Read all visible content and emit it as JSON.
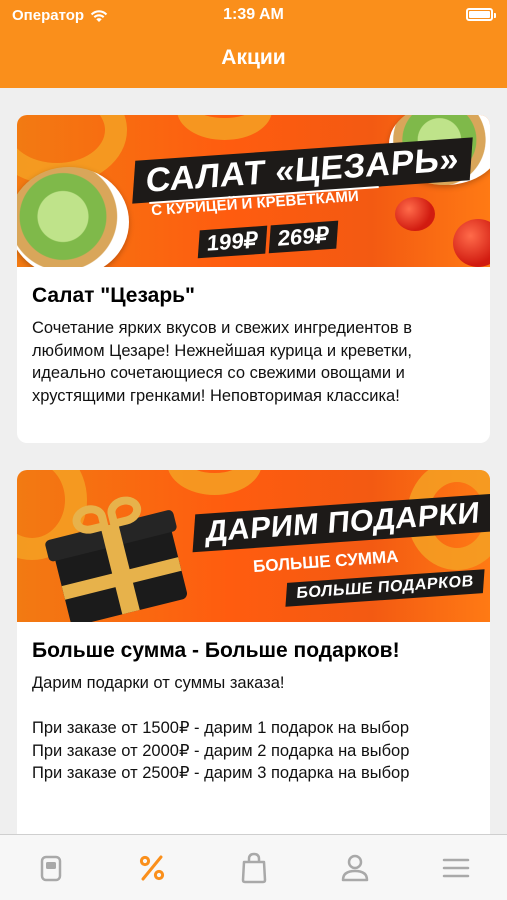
{
  "status_bar": {
    "carrier": "Оператор",
    "time": "1:39 AM"
  },
  "nav": {
    "title": "Акции"
  },
  "colors": {
    "accent": "#fa8f1b",
    "tab_inactive": "#a9a9a9",
    "tab_active": "#fa8f1b"
  },
  "promos": [
    {
      "banner": {
        "headline": "САЛАТ «ЦЕЗАРЬ»",
        "subline": "С КУРИЦЕЙ И КРЕВЕТКАМИ",
        "prices": [
          "199₽",
          "269₽"
        ]
      },
      "title": "Салат \"Цезарь\"",
      "text": "Сочетание ярких вкусов и свежих ингредиентов в любимом Цезаре! Нежнейшая курица и креветки, идеально сочетающиеся со свежими овощами и хрустящими гренками! Неповторимая классика!"
    },
    {
      "banner": {
        "headline": "ДАРИМ ПОДАРКИ",
        "subline": "БОЛЬШЕ СУММА",
        "subline2": "БОЛЬШЕ ПОДАРКОВ"
      },
      "title": "Больше сумма - Больше подарков!",
      "text": "Дарим подарки от суммы заказа!\n\nПри заказе от 1500₽ - дарим 1 подарок на выбор\nПри заказе от 2000₽ - дарим 2 подарка на выбор\nПри заказе от 2500₽ - дарим 3 подарка на выбор"
    }
  ],
  "tabbar": {
    "active_index": 1,
    "items": [
      {
        "icon": "menu-card-icon"
      },
      {
        "icon": "percent-icon"
      },
      {
        "icon": "shopping-bag-icon"
      },
      {
        "icon": "profile-icon"
      },
      {
        "icon": "hamburger-icon"
      }
    ]
  }
}
